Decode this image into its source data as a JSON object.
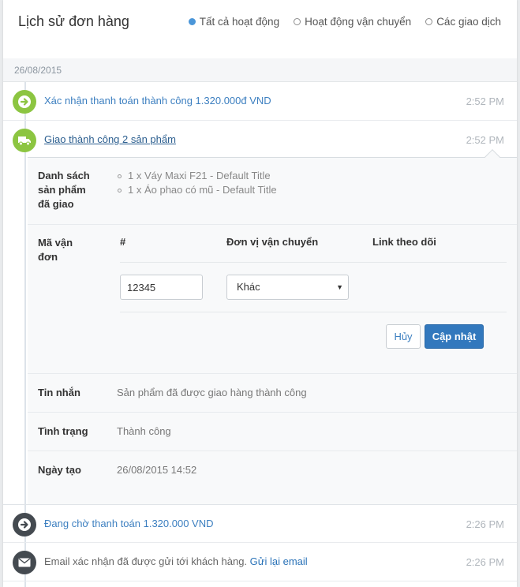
{
  "header": {
    "title": "Lịch sử đơn hàng",
    "filters": [
      {
        "label": "Tất cả hoạt động",
        "checked": true
      },
      {
        "label": "Hoạt động vận chuyển",
        "checked": false
      },
      {
        "label": "Các giao dịch",
        "checked": false
      }
    ]
  },
  "date_group": "26/08/2015",
  "events": [
    {
      "text": "Xác nhận thanh toán thành công 1.320.000đ VND",
      "time": "2:52 PM",
      "icon": "arrow-right-icon"
    },
    {
      "text": "Giao thành công 2 sản phẩm",
      "time": "2:52 PM",
      "icon": "truck-icon"
    },
    {
      "text": "Đang chờ thanh toán 1.320.000 VND",
      "time": "2:26 PM",
      "icon": "arrow-right-icon"
    },
    {
      "text": "Email xác nhận đã được gửi tới khách hàng.",
      "link": "Gửi lại email",
      "time": "2:26 PM",
      "icon": "envelope-icon"
    }
  ],
  "details": {
    "products_label": "Danh sách sản phẩm đã giao",
    "products_label_lines": [
      "Danh sách",
      "sản phẩm",
      "đã giao"
    ],
    "products": [
      "1 x Váy Maxi F21 - Default Title",
      "1 x Áo phao có mũ - Default Title"
    ],
    "tracking_label_lines": [
      "Mã vận",
      "đơn"
    ],
    "columns": [
      "#",
      "Đơn vị vận chuyển",
      "Link theo dõi"
    ],
    "tracking_number": "12345",
    "carrier_selected": "Khác",
    "cancel_label": "Hủy",
    "update_label": "Cập nhật",
    "message_label": "Tin nhắn",
    "message_value": "Sản phẩm đã được giao hàng thành công",
    "status_label": "Tình trạng",
    "status_value": "Thành công",
    "created_label": "Ngày tạo",
    "created_value": "26/08/2015 14:52"
  },
  "colors": {
    "accent": "#3278bd",
    "green_icon": "#8cc541",
    "dark_icon": "#444a50",
    "link": "#3c7fc0"
  }
}
